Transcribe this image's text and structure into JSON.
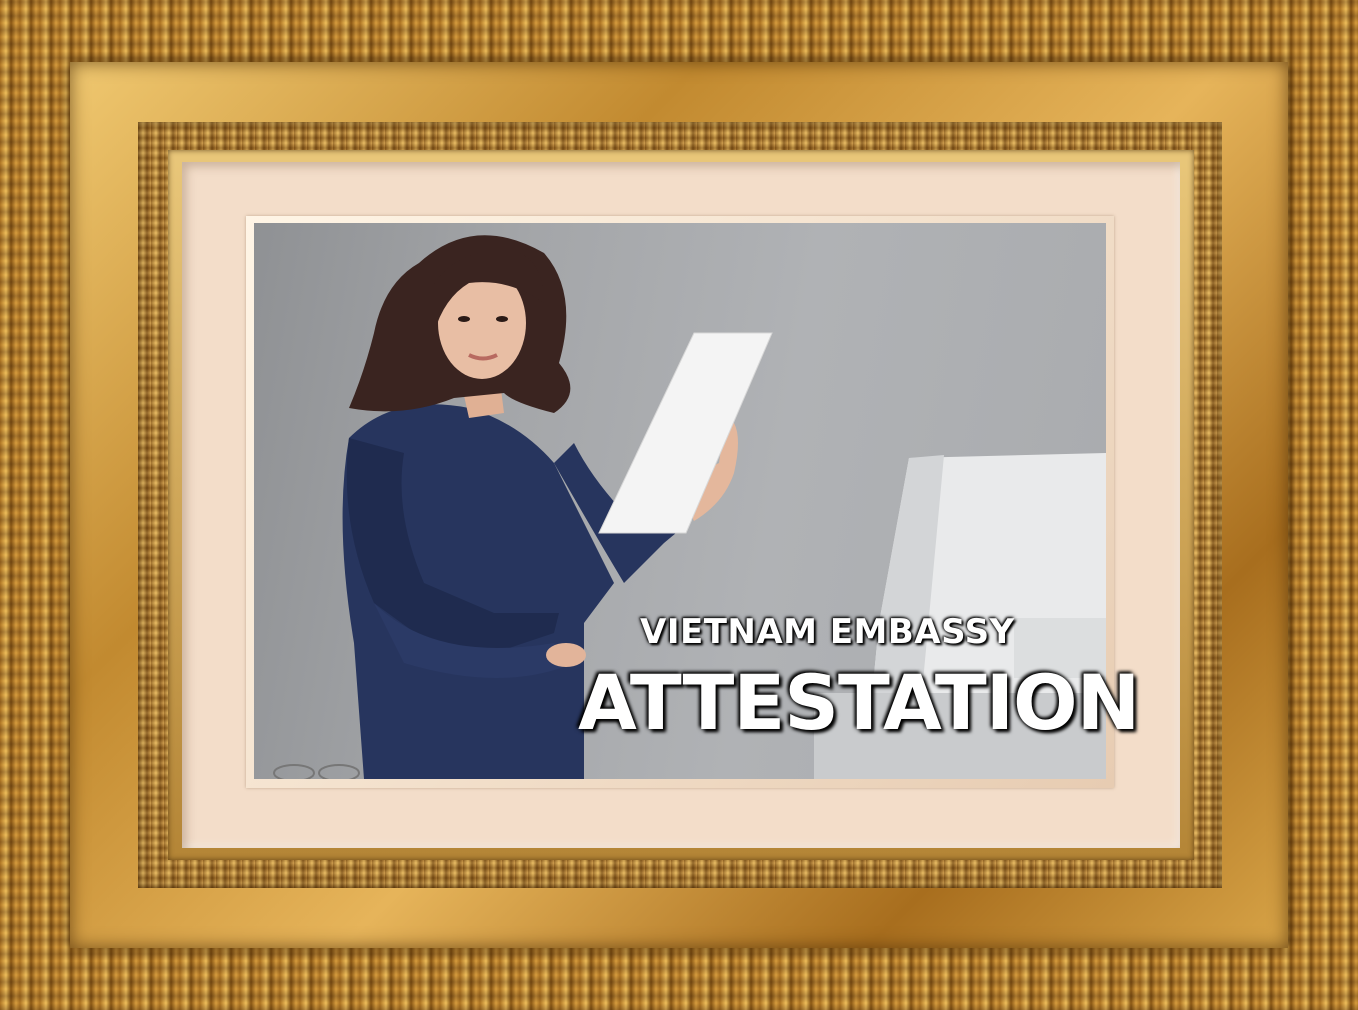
{
  "caption": {
    "line1": "VIETNAM EMBASSY",
    "line2": "ATTESTATION"
  },
  "colors": {
    "frame_gold": "#d9a447",
    "mat": "#f3ddc9",
    "caption_text": "#ffffff",
    "shirt": "#27355e",
    "backdrop": "#a4a6a9"
  }
}
